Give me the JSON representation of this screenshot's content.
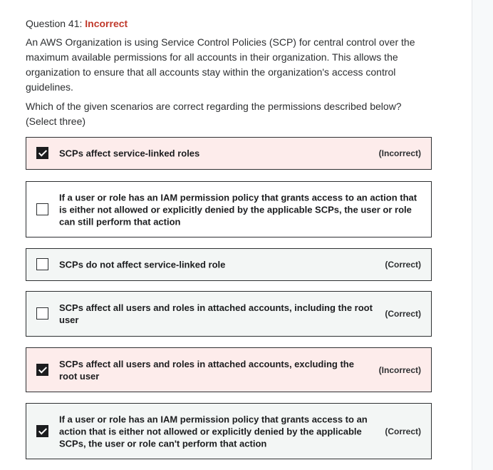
{
  "header": {
    "question_label": "Question 41:",
    "status": "Incorrect"
  },
  "question": {
    "paragraph1": "An AWS Organization is using Service Control Policies (SCP) for central control over the maximum available permissions for all accounts in their organization. This allows the organization to ensure that all accounts stay within the organization's access control guidelines.",
    "paragraph2": "Which of the given scenarios are correct regarding the permissions described below? (Select three)"
  },
  "options": [
    {
      "text": "SCPs affect service-linked roles",
      "checked": true,
      "result": "(Incorrect)"
    },
    {
      "text": "If a user or role has an IAM permission policy that grants access to an action that is either not allowed or explicitly denied by the applicable SCPs, the user or role can still perform that action",
      "checked": false,
      "result": ""
    },
    {
      "text": "SCPs do not affect service-linked role",
      "checked": false,
      "result": "(Correct)"
    },
    {
      "text": "SCPs affect all users and roles in attached accounts, including the root user",
      "checked": false,
      "result": "(Correct)"
    },
    {
      "text": "SCPs affect all users and roles in attached accounts, excluding the root user",
      "checked": true,
      "result": "(Incorrect)"
    },
    {
      "text": "If a user or role has an IAM permission policy that grants access to an action that is either not allowed or explicitly denied by the applicable SCPs, the user or role can't perform that action",
      "checked": true,
      "result": "(Correct)"
    }
  ],
  "colors": {
    "incorrect_text": "#c0392b",
    "incorrect_bg": "#fdeceb",
    "correct_bg": "#f3f6f5",
    "border": "#2d2f31"
  }
}
